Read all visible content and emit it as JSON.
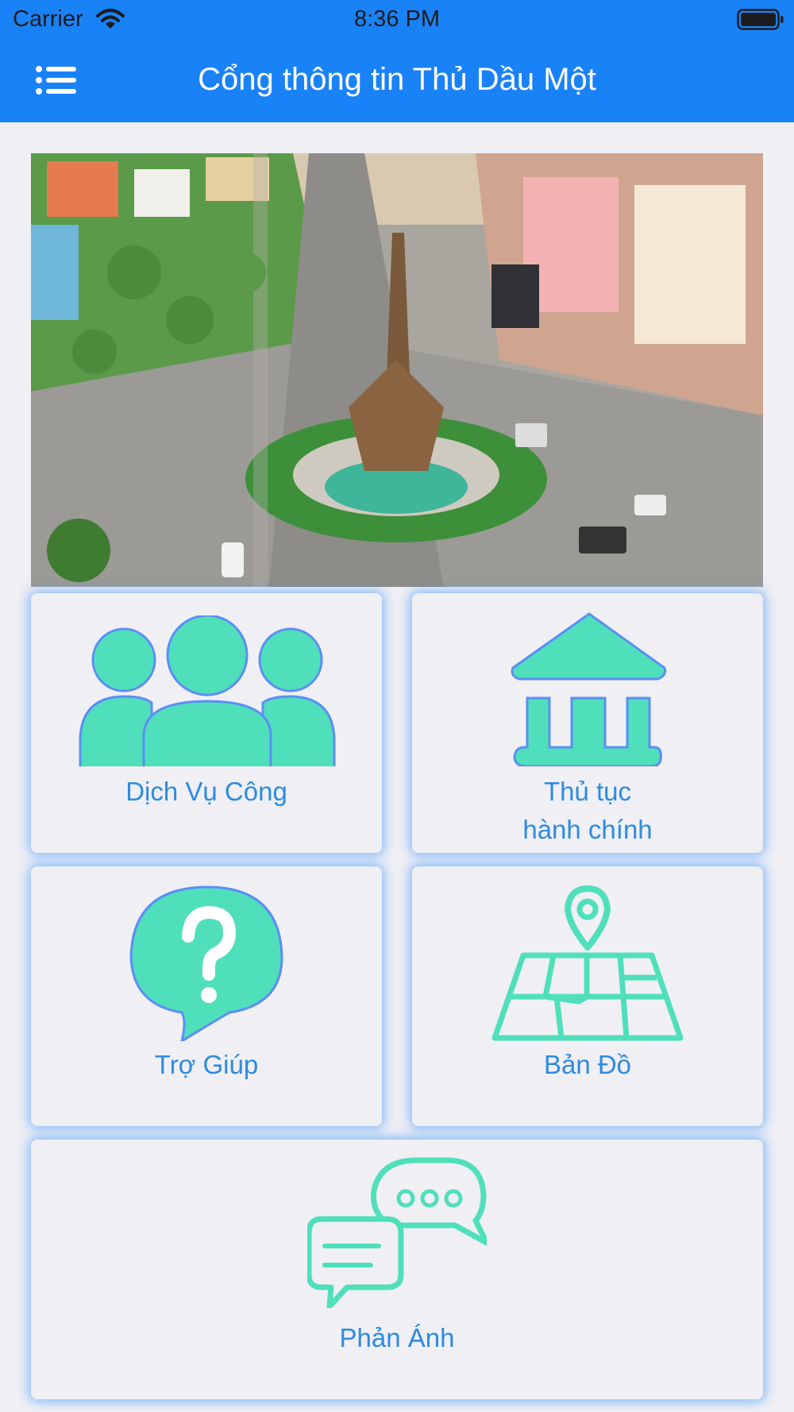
{
  "status_bar": {
    "carrier": "Carrier",
    "time": "8:36 PM"
  },
  "nav_bar": {
    "title": "Cổng thông tin Thủ Dầu Một",
    "menu_icon": "hamburger-menu-icon"
  },
  "banner": {
    "image": "city-roundabout-photo"
  },
  "tiles": {
    "public_service": {
      "label": "Dịch Vụ Công",
      "icon": "people-group-icon"
    },
    "admin_procedure": {
      "label_line1": "Thủ tục",
      "label_line2": "hành chính",
      "icon": "government-building-icon"
    },
    "help": {
      "label": "Trợ Giúp",
      "icon": "question-bubble-icon"
    },
    "map": {
      "label": "Bản Đồ",
      "icon": "map-pin-icon"
    },
    "feedback": {
      "label": "Phản Ánh",
      "icon": "chat-bubbles-icon"
    }
  },
  "colors": {
    "header": "#1a82f7",
    "icon_fill": "#4fdfbb",
    "icon_stroke": "#5c8ef5",
    "label": "#2d8be0",
    "background": "#efeff4"
  }
}
